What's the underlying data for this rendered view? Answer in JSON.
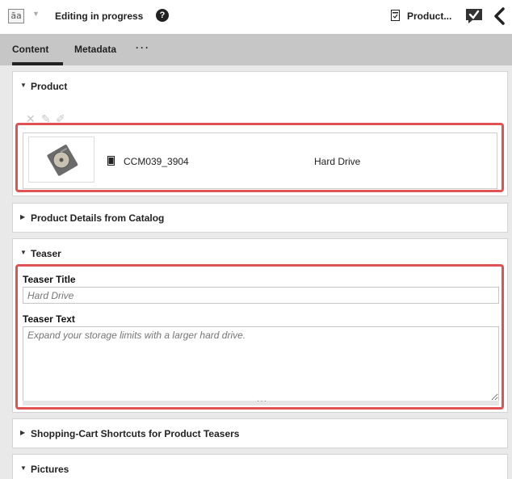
{
  "header": {
    "doc_type_icon": "article-content-icon",
    "doc_type_glyph": "āa",
    "status": "Editing in progress",
    "help_glyph": "?",
    "product_title": "Product...",
    "approve_icon": "approve-check-icon",
    "back_icon": "chevron-left-icon"
  },
  "tabs": [
    {
      "label": "Content",
      "active": true
    },
    {
      "label": "Metadata",
      "active": false
    },
    {
      "label": "···",
      "active": false
    }
  ],
  "product_panel": {
    "title": "Product",
    "expanded": true,
    "toolbar_icons": [
      "remove-icon",
      "edit-icon",
      "open-icon"
    ],
    "row": {
      "thumbnail": "hard-drive-image",
      "id": "CCM039_3904",
      "name": "Hard Drive"
    }
  },
  "details_panel": {
    "title": "Product Details from Catalog",
    "expanded": false
  },
  "teaser_panel": {
    "title": "Teaser",
    "expanded": true,
    "title_label": "Teaser Title",
    "title_placeholder": "Hard Drive",
    "text_label": "Teaser Text",
    "text_placeholder": "Expand your storage limits with a larger hard drive.",
    "resize_glyph": "···"
  },
  "shopping_panel": {
    "title": "Shopping-Cart Shortcuts for Product Teasers",
    "expanded": false
  },
  "pictures_panel": {
    "title": "Pictures",
    "expanded": true
  },
  "colors": {
    "highlight": "#e05254",
    "tabbar": "#c6c6c6",
    "background": "#e9e9e9"
  }
}
